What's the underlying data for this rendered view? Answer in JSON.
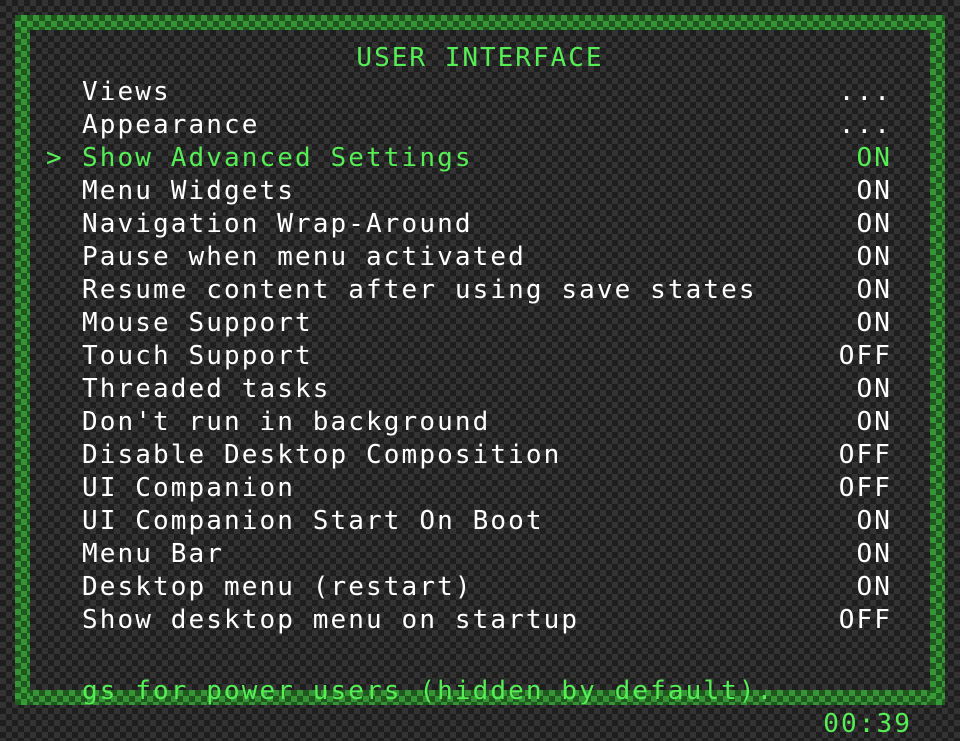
{
  "title": "USER INTERFACE",
  "cursor_glyph": ">",
  "menu": {
    "items": [
      {
        "label": "Views",
        "value": "...",
        "selected": false
      },
      {
        "label": "Appearance",
        "value": "...",
        "selected": false
      },
      {
        "label": "Show Advanced Settings",
        "value": "ON",
        "selected": true
      },
      {
        "label": "Menu Widgets",
        "value": "ON",
        "selected": false
      },
      {
        "label": "Navigation Wrap-Around",
        "value": "ON",
        "selected": false
      },
      {
        "label": "Pause when menu activated",
        "value": "ON",
        "selected": false
      },
      {
        "label": "Resume content after using save states",
        "value": "ON",
        "selected": false
      },
      {
        "label": "Mouse Support",
        "value": "ON",
        "selected": false
      },
      {
        "label": "Touch Support",
        "value": "OFF",
        "selected": false
      },
      {
        "label": "Threaded tasks",
        "value": "ON",
        "selected": false
      },
      {
        "label": "Don't run in background",
        "value": "ON",
        "selected": false
      },
      {
        "label": "Disable Desktop Composition",
        "value": "OFF",
        "selected": false
      },
      {
        "label": "UI Companion",
        "value": "OFF",
        "selected": false
      },
      {
        "label": "UI Companion Start On Boot",
        "value": "ON",
        "selected": false
      },
      {
        "label": "Menu Bar",
        "value": "ON",
        "selected": false
      },
      {
        "label": "Desktop menu (restart)",
        "value": "ON",
        "selected": false
      },
      {
        "label": "Show desktop menu on startup",
        "value": "OFF",
        "selected": false
      }
    ]
  },
  "footer": {
    "sublabel": "gs for power users (hidden by default).",
    "clock": "00:39"
  },
  "colors": {
    "accent": "#55ee55",
    "text": "#ffffff",
    "border_green": "#38a038",
    "background_dark": "#1e1e1e",
    "background_light": "#333333"
  }
}
